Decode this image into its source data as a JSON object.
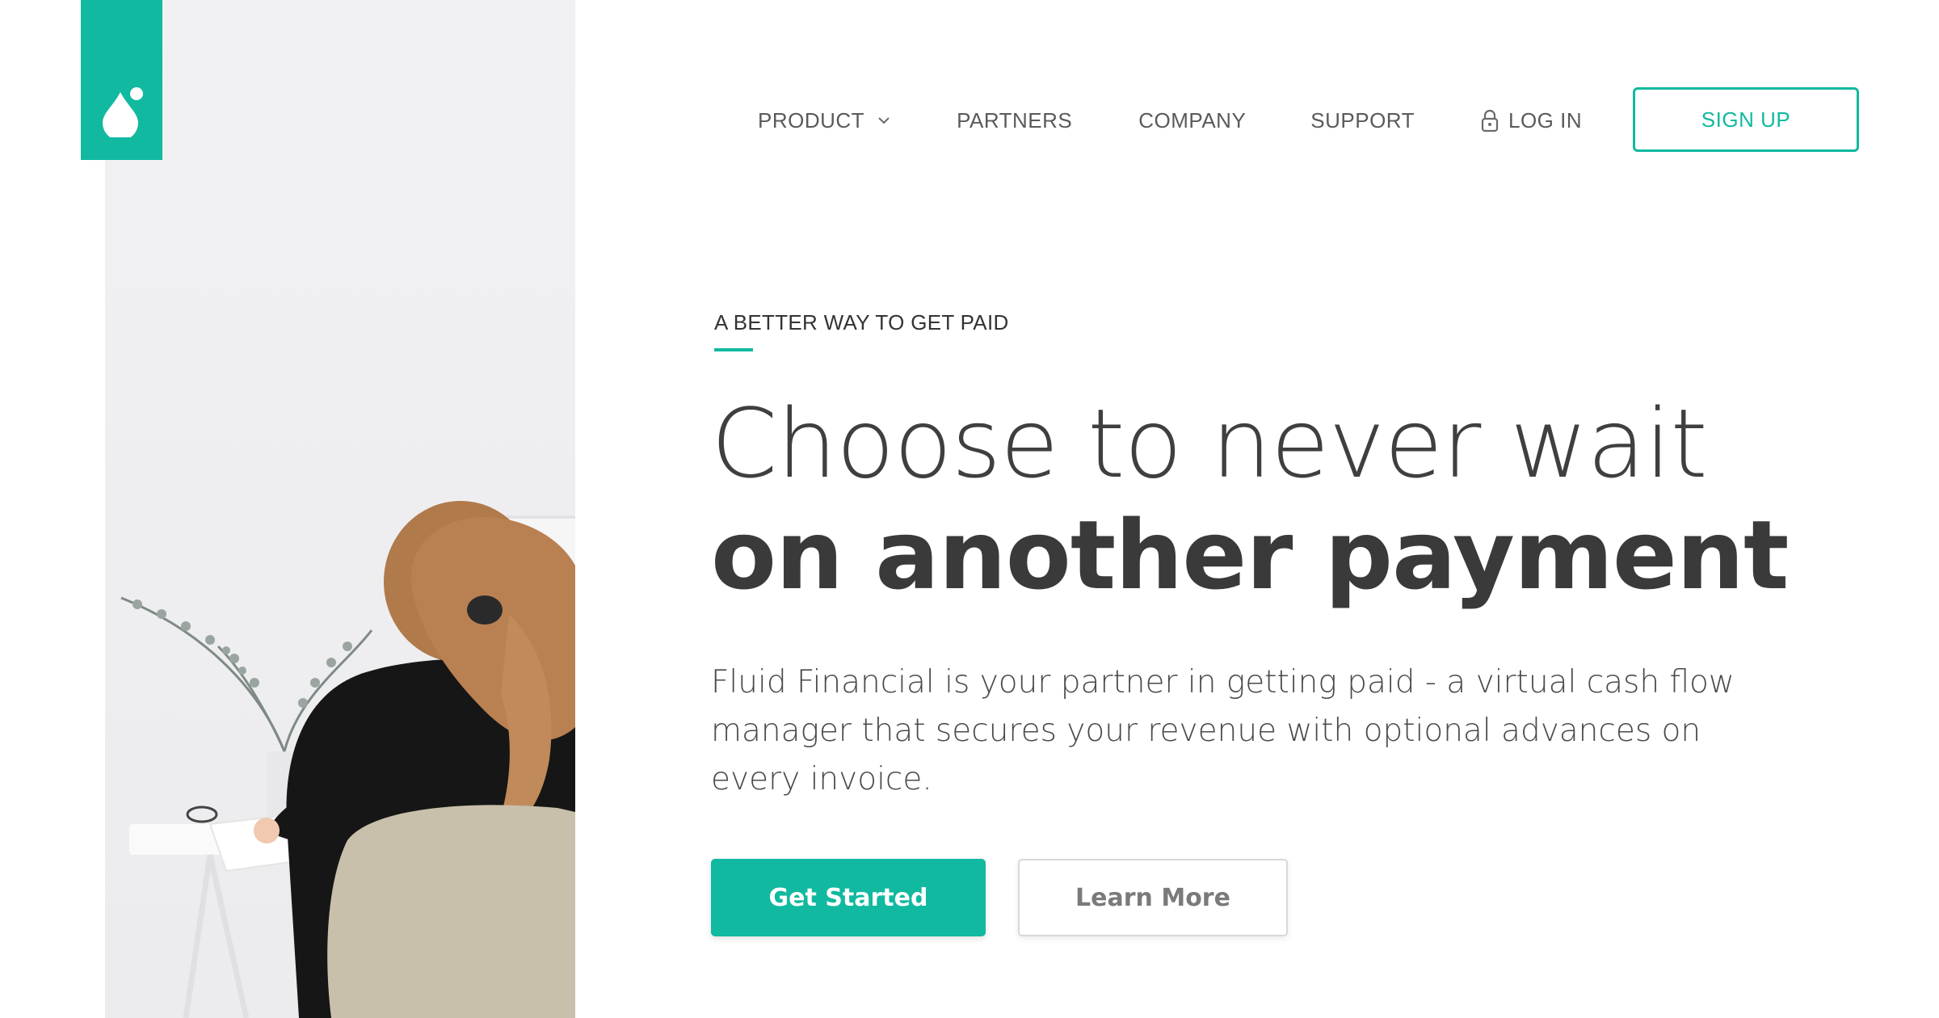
{
  "brand": {
    "logo_icon": "droplet-icon",
    "accent": "#11b9a0"
  },
  "nav": {
    "product": "PRODUCT",
    "partners": "PARTNERS",
    "company": "COMPANY",
    "support": "SUPPORT",
    "login": "LOG IN",
    "signup": "SIGN UP"
  },
  "hero": {
    "eyebrow": "A BETTER WAY TO GET PAID",
    "headline_light": "Choose to never wait",
    "headline_bold": "on another payment",
    "lede": "Fluid Financial is your partner in getting paid - a virtual cash flow manager that secures your revenue with optional advances on every invoice.",
    "primary_cta": "Get Started",
    "secondary_cta": "Learn More"
  }
}
